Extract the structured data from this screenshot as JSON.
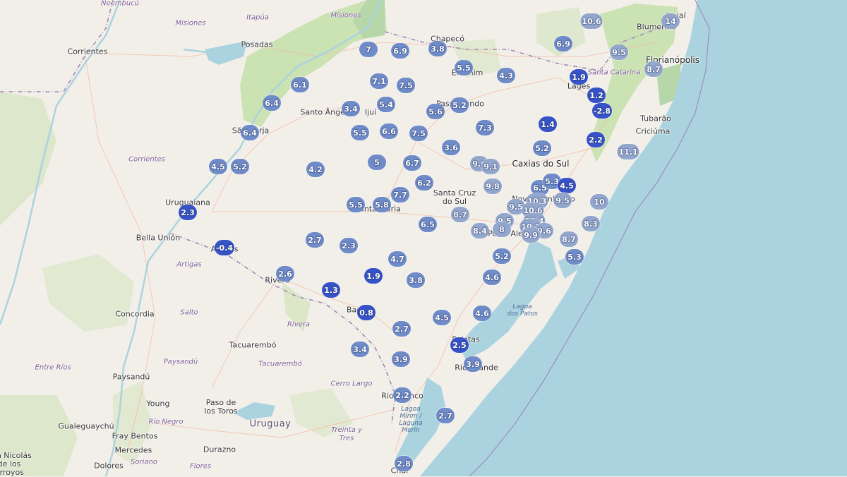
{
  "map": {
    "colors": {
      "land": "#f2efe9",
      "ocean": "#aad3df",
      "forest": "#c5dfa9",
      "road": "#f4b9a3",
      "border": "#a28ab5",
      "marker_light": "#93a6cc",
      "marker_mid": "#6f8bc8",
      "marker_dark": "#3653c8"
    },
    "cities": [
      {
        "text": "Ñeembucú",
        "cls": "region"
      },
      {
        "text": "Itapúa",
        "cls": "region"
      },
      {
        "text": "Misiones",
        "cls": "region"
      },
      {
        "text": "Misiones",
        "cls": "region"
      },
      {
        "text": "Corrientes",
        "cls": "city"
      },
      {
        "text": "Posadas",
        "cls": "city"
      },
      {
        "text": "Chapecó",
        "cls": "city"
      },
      {
        "text": "Erechim",
        "cls": "city"
      },
      {
        "text": "Lages",
        "cls": "city"
      },
      {
        "text": "Blumenau",
        "cls": "city"
      },
      {
        "text": "Itajaí",
        "cls": "city"
      },
      {
        "text": "Florianópolis",
        "cls": "city big"
      },
      {
        "text": "Santa Catarina",
        "cls": "region"
      },
      {
        "text": "Tubarão",
        "cls": "city"
      },
      {
        "text": "Criciúma",
        "cls": "city"
      },
      {
        "text": "Santo Ângelo",
        "cls": "city"
      },
      {
        "text": "Ijuí",
        "cls": "city"
      },
      {
        "text": "Passo Fundo",
        "cls": "city"
      },
      {
        "text": "São Borja",
        "cls": "city"
      },
      {
        "text": "Caxias do Sul",
        "cls": "city big"
      },
      {
        "text": "Corrientes",
        "cls": "region"
      },
      {
        "text": "Santa Cruz\ndo Sul",
        "cls": "city multi"
      },
      {
        "text": "Santa Maria",
        "cls": "city"
      },
      {
        "text": "Novo Hamburgo",
        "cls": "city"
      },
      {
        "text": "Porto Alegre",
        "cls": "city"
      },
      {
        "text": "Uruguaiana",
        "cls": "city"
      },
      {
        "text": "Bella Unión",
        "cls": "city"
      },
      {
        "text": "Artigas",
        "cls": "region"
      },
      {
        "text": "Artigas",
        "cls": "city"
      },
      {
        "text": "Rivera",
        "cls": "city"
      },
      {
        "text": "Salto",
        "cls": "region"
      },
      {
        "text": "Concordia",
        "cls": "city"
      },
      {
        "text": "Rivera",
        "cls": "region"
      },
      {
        "text": "Bagé",
        "cls": "city"
      },
      {
        "text": "Lagoa\ndos Patos",
        "cls": "water"
      },
      {
        "text": "Pelotas",
        "cls": "city"
      },
      {
        "text": "Tacuarembó",
        "cls": "city"
      },
      {
        "text": "Tacuarembó",
        "cls": "region"
      },
      {
        "text": "Entre Ríos",
        "cls": "region"
      },
      {
        "text": "Paysandú",
        "cls": "region"
      },
      {
        "text": "Paysandú",
        "cls": "city"
      },
      {
        "text": "Rio Grande",
        "cls": "city"
      },
      {
        "text": "Cerro Largo",
        "cls": "region"
      },
      {
        "text": "Rio Branco",
        "cls": "city"
      },
      {
        "text": "Young",
        "cls": "city"
      },
      {
        "text": "Paso de\nlos Toros",
        "cls": "city multi"
      },
      {
        "text": "Lagoa\nMirim /\nLaguna\nMerín",
        "cls": "water"
      },
      {
        "text": "Gualeguaychú",
        "cls": "city"
      },
      {
        "text": "Río Negro",
        "cls": "region"
      },
      {
        "text": "Uruguay",
        "cls": "country"
      },
      {
        "text": "Treinta y\nTres",
        "cls": "region multi"
      },
      {
        "text": "Fray Bentos",
        "cls": "city"
      },
      {
        "text": "Mercedes",
        "cls": "city"
      },
      {
        "text": "Durazno",
        "cls": "city"
      },
      {
        "text": "San Nicolás\nde los\nArroyos",
        "cls": "city multi"
      },
      {
        "text": "Soriano",
        "cls": "region"
      },
      {
        "text": "Flores",
        "cls": "region"
      },
      {
        "text": "Dolores",
        "cls": "city"
      },
      {
        "text": "Chuí",
        "cls": "city"
      }
    ],
    "stations": [
      {
        "value": "10.6",
        "shade": "l"
      },
      {
        "value": "14",
        "shade": "l"
      },
      {
        "value": "6.9",
        "shade": "m"
      },
      {
        "value": "9.5",
        "shade": "l"
      },
      {
        "value": "8.7",
        "shade": "l"
      },
      {
        "value": "1.9",
        "shade": "d"
      },
      {
        "value": "1.2",
        "shade": "d"
      },
      {
        "value": "-2.8",
        "shade": "d"
      },
      {
        "value": "2.2",
        "shade": "d"
      },
      {
        "value": "11.1",
        "shade": "l"
      },
      {
        "value": "7",
        "shade": "m"
      },
      {
        "value": "6.9",
        "shade": "m"
      },
      {
        "value": "3.8",
        "shade": "m"
      },
      {
        "value": "5.5",
        "shade": "m"
      },
      {
        "value": "4.3",
        "shade": "m"
      },
      {
        "value": "6.1",
        "shade": "m"
      },
      {
        "value": "7.1",
        "shade": "m"
      },
      {
        "value": "7.5",
        "shade": "m"
      },
      {
        "value": "6.4",
        "shade": "m"
      },
      {
        "value": "3.4",
        "shade": "m"
      },
      {
        "value": "5.4",
        "shade": "m"
      },
      {
        "value": "5.6",
        "shade": "m"
      },
      {
        "value": "5.2",
        "shade": "m"
      },
      {
        "value": "6.4",
        "shade": "m"
      },
      {
        "value": "5.5",
        "shade": "m"
      },
      {
        "value": "6.6",
        "shade": "m"
      },
      {
        "value": "7.5",
        "shade": "m"
      },
      {
        "value": "7.3",
        "shade": "m"
      },
      {
        "value": "1.4",
        "shade": "d"
      },
      {
        "value": "5.2",
        "shade": "m"
      },
      {
        "value": "3.6",
        "shade": "m"
      },
      {
        "value": "4.5",
        "shade": "m"
      },
      {
        "value": "5.2",
        "shade": "m"
      },
      {
        "value": "4.2",
        "shade": "m"
      },
      {
        "value": "5",
        "shade": "m"
      },
      {
        "value": "6.7",
        "shade": "m"
      },
      {
        "value": "9.6",
        "shade": "l"
      },
      {
        "value": "9.1",
        "shade": "l"
      },
      {
        "value": "6.2",
        "shade": "m"
      },
      {
        "value": "9.8",
        "shade": "l"
      },
      {
        "value": "6.5",
        "shade": "m"
      },
      {
        "value": "5.3",
        "shade": "m"
      },
      {
        "value": "4.5",
        "shade": "d"
      },
      {
        "value": "7.7",
        "shade": "m"
      },
      {
        "value": "10.3",
        "shade": "l"
      },
      {
        "value": "9.5",
        "shade": "l"
      },
      {
        "value": "2.3",
        "shade": "d"
      },
      {
        "value": "5.5",
        "shade": "m"
      },
      {
        "value": "5.8",
        "shade": "m"
      },
      {
        "value": "9.5",
        "shade": "l"
      },
      {
        "value": "10.6",
        "shade": "l"
      },
      {
        "value": "10",
        "shade": "l"
      },
      {
        "value": "8.7",
        "shade": "l"
      },
      {
        "value": "9.5",
        "shade": "l"
      },
      {
        "value": "10.4",
        "shade": "l"
      },
      {
        "value": "6.5",
        "shade": "m"
      },
      {
        "value": "8.4",
        "shade": "l"
      },
      {
        "value": "8",
        "shade": "l"
      },
      {
        "value": "10.2",
        "shade": "l"
      },
      {
        "value": "9.6",
        "shade": "l"
      },
      {
        "value": "8.3",
        "shade": "l"
      },
      {
        "value": "9.9",
        "shade": "l"
      },
      {
        "value": "-0.4",
        "shade": "d"
      },
      {
        "value": "2.7",
        "shade": "m"
      },
      {
        "value": "2.3",
        "shade": "m"
      },
      {
        "value": "8.7",
        "shade": "l"
      },
      {
        "value": "5.2",
        "shade": "m"
      },
      {
        "value": "5.3",
        "shade": "m"
      },
      {
        "value": "4.7",
        "shade": "m"
      },
      {
        "value": "2.6",
        "shade": "m"
      },
      {
        "value": "1.9",
        "shade": "d"
      },
      {
        "value": "3.8",
        "shade": "m"
      },
      {
        "value": "4.6",
        "shade": "m"
      },
      {
        "value": "1.3",
        "shade": "d"
      },
      {
        "value": "0.8",
        "shade": "d"
      },
      {
        "value": "4.5",
        "shade": "m"
      },
      {
        "value": "4.6",
        "shade": "m"
      },
      {
        "value": "2.7",
        "shade": "m"
      },
      {
        "value": "2.5",
        "shade": "d"
      },
      {
        "value": "3.4",
        "shade": "m"
      },
      {
        "value": "3.9",
        "shade": "m"
      },
      {
        "value": "3.9",
        "shade": "m"
      },
      {
        "value": "2.2",
        "shade": "m"
      },
      {
        "value": "2.7",
        "shade": "m"
      },
      {
        "value": "2.8",
        "shade": "m"
      }
    ]
  }
}
